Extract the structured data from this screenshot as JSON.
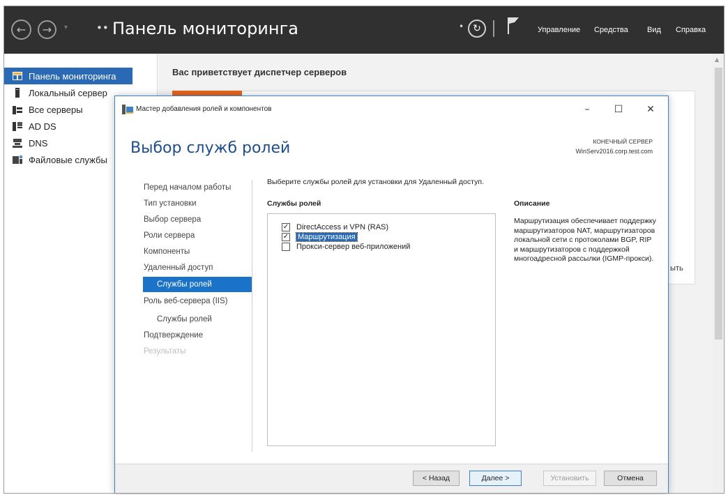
{
  "app": {
    "title": "Панель мониторинга",
    "title_marker": "••"
  },
  "menu": [
    "Управление",
    "Средства",
    "Вид",
    "Справка"
  ],
  "sidebar": {
    "items": [
      {
        "label": "Панель мониторинга",
        "icon": "dashboard-icon",
        "active": true
      },
      {
        "label": "Локальный сервер",
        "icon": "server-icon"
      },
      {
        "label": "Все серверы",
        "icon": "servers-icon"
      },
      {
        "label": "AD DS",
        "icon": "ad-ds-icon"
      },
      {
        "label": "DNS",
        "icon": "dns-icon"
      },
      {
        "label": "Файловые службы",
        "icon": "file-services-icon"
      }
    ]
  },
  "main": {
    "welcome": "Вас приветствует диспетчер серверов",
    "behind_text": "ыть"
  },
  "dialog": {
    "window_title": "Мастер добавления ролей и компонентов",
    "page_title": "Выбор служб ролей",
    "dest_label": "КОНЕЧНЫЙ СЕРВЕР",
    "dest_server": "WinServ2016.corp.test.com",
    "steps": [
      {
        "label": "Перед началом работы"
      },
      {
        "label": "Тип установки"
      },
      {
        "label": "Выбор сервера"
      },
      {
        "label": "Роли сервера"
      },
      {
        "label": "Компоненты"
      },
      {
        "label": "Удаленный доступ"
      },
      {
        "label": "Службы ролей",
        "active": true
      },
      {
        "label": "Роль веб-сервера (IIS)"
      },
      {
        "label": "Службы ролей"
      },
      {
        "label": "Подтверждение"
      },
      {
        "label": "Результаты",
        "disabled": true
      }
    ],
    "instruction": "Выберите службы ролей для установки для Удаленный доступ.",
    "roles_header": "Службы ролей",
    "roles": [
      {
        "label": "DirectAccess и VPN (RAS)",
        "checked": true
      },
      {
        "label": "Маршрутизация",
        "checked": true,
        "selected": true
      },
      {
        "label": "Прокси-сервер веб-приложений",
        "checked": false
      }
    ],
    "desc_header": "Описание",
    "description": "Маршрутизация обеспечивает поддержку маршрутизаторов NAT, маршрутизаторов локальной сети с протоколами BGP, RIP и маршрутизаторов с поддержкой многоадресной рассылки (IGMP-прокси).",
    "buttons": {
      "back": "< Назад",
      "next": "Далее >",
      "install": "Установить",
      "cancel": "Отмена"
    }
  },
  "colors": {
    "titlebar": "#303030",
    "accent": "#2a6ab5",
    "dialog_title": "#1e4e8c",
    "tile_orange": "#e8641b"
  }
}
